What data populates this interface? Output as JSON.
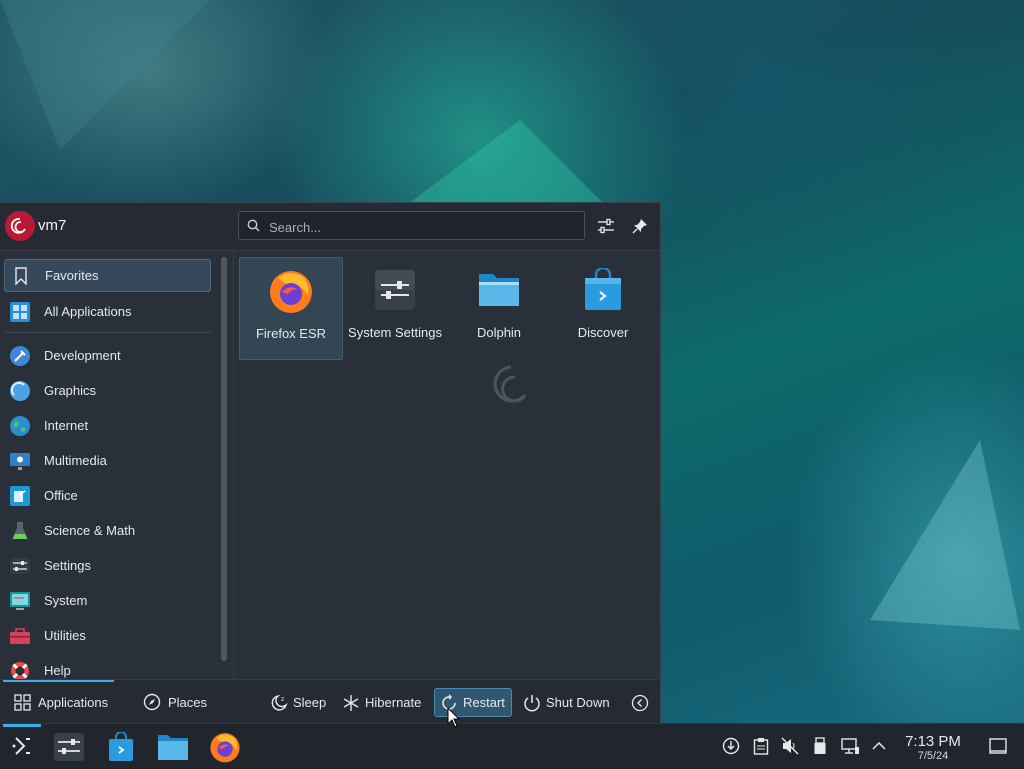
{
  "launcher": {
    "user": {
      "name": "vm7",
      "avatar_icon": "debian-swirl-icon"
    },
    "search": {
      "placeholder": "Search...",
      "value": ""
    },
    "header_buttons": [
      {
        "icon": "configure-sliders-icon"
      },
      {
        "icon": "pin-icon"
      }
    ],
    "categories": [
      {
        "label": "Favorites",
        "icon": "bookmark-icon",
        "active": true
      },
      {
        "label": "All Applications",
        "icon": "grid-apps-icon"
      },
      {
        "label": "Development",
        "icon": "development-icon"
      },
      {
        "label": "Graphics",
        "icon": "graphics-icon"
      },
      {
        "label": "Internet",
        "icon": "internet-globe-icon"
      },
      {
        "label": "Multimedia",
        "icon": "multimedia-icon"
      },
      {
        "label": "Office",
        "icon": "office-icon"
      },
      {
        "label": "Science & Math",
        "icon": "science-flask-icon"
      },
      {
        "label": "Settings",
        "icon": "settings-icon"
      },
      {
        "label": "System",
        "icon": "system-icon"
      },
      {
        "label": "Utilities",
        "icon": "utilities-toolbox-icon"
      },
      {
        "label": "Help",
        "icon": "help-lifebuoy-icon"
      }
    ],
    "favorites": [
      {
        "label": "Firefox ESR",
        "icon": "firefox-icon"
      },
      {
        "label": "System Settings",
        "icon": "system-settings-icon"
      },
      {
        "label": "Dolphin",
        "icon": "folder-icon"
      },
      {
        "label": "Discover",
        "icon": "discover-bag-icon"
      }
    ],
    "footer": {
      "tabs": [
        {
          "label": "Applications",
          "icon": "grid-apps-icon",
          "active": true
        },
        {
          "label": "Places",
          "icon": "compass-icon"
        }
      ],
      "power_buttons": [
        {
          "label": "Sleep",
          "icon": "sleep-moon-icon"
        },
        {
          "label": "Hibernate",
          "icon": "hibernate-snowflake-icon"
        },
        {
          "label": "Restart",
          "icon": "restart-icon",
          "hover": true
        },
        {
          "label": "Shut Down",
          "icon": "power-icon"
        }
      ],
      "more_icon": "chevron-left-icon"
    }
  },
  "taskbar": {
    "launcher_icon": "kde-launcher-icon",
    "pinned_apps": [
      {
        "name": "System Settings",
        "icon": "system-settings-icon"
      },
      {
        "name": "Discover",
        "icon": "discover-bag-icon"
      },
      {
        "name": "Dolphin",
        "icon": "folder-icon"
      },
      {
        "name": "Firefox ESR",
        "icon": "firefox-icon"
      }
    ],
    "tray_icons": [
      "update-icon",
      "clipboard-icon",
      "volume-muted-icon",
      "usb-device-icon",
      "network-wired-icon",
      "chevron-up-icon"
    ],
    "clock": {
      "time": "7:13 PM",
      "date": "7/5/24"
    },
    "show_desktop_icon": "show-desktop-icon"
  },
  "colors": {
    "accent": "#3daee9",
    "panel": "#2a3039",
    "debian_red": "#b81a35"
  }
}
